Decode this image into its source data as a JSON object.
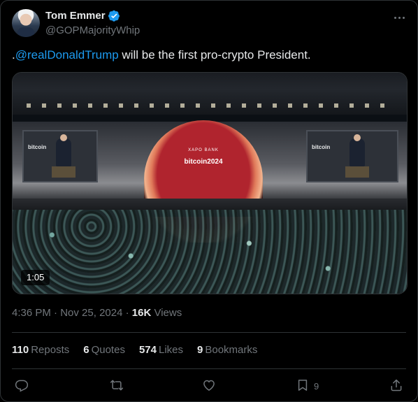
{
  "author": {
    "display_name": "Tom Emmer",
    "handle": "@GOPMajorityWhip",
    "verified": true
  },
  "tweet": {
    "prefix": ".",
    "mention": "@realDonaldTrump",
    "text_rest": " will be the first pro-crypto President."
  },
  "media": {
    "duration": "1:05",
    "stage_label_top": "XAPO BANK",
    "stage_label_main": "bitcoin2024",
    "screen_brand": "bitcoin"
  },
  "meta": {
    "time": "4:36 PM",
    "sep1": " · ",
    "date": "Nov 25, 2024",
    "sep2": " · ",
    "views_count": "16K",
    "views_label": " Views"
  },
  "stats": {
    "reposts_count": "110",
    "reposts_label": "Reposts",
    "quotes_count": "6",
    "quotes_label": "Quotes",
    "likes_count": "574",
    "likes_label": "Likes",
    "bookmarks_count": "9",
    "bookmarks_label": "Bookmarks"
  },
  "actions": {
    "bookmark_count": "9"
  },
  "icons": {
    "verified": "verified-badge-icon",
    "more": "more-options-icon",
    "reply": "reply-icon",
    "retweet": "retweet-icon",
    "like": "heart-icon",
    "bookmark": "bookmark-icon",
    "share": "share-icon"
  },
  "colors": {
    "background": "#000000",
    "text": "#e7e9ea",
    "muted": "#71767b",
    "accent": "#1d9bf0",
    "border": "#2f3336"
  }
}
